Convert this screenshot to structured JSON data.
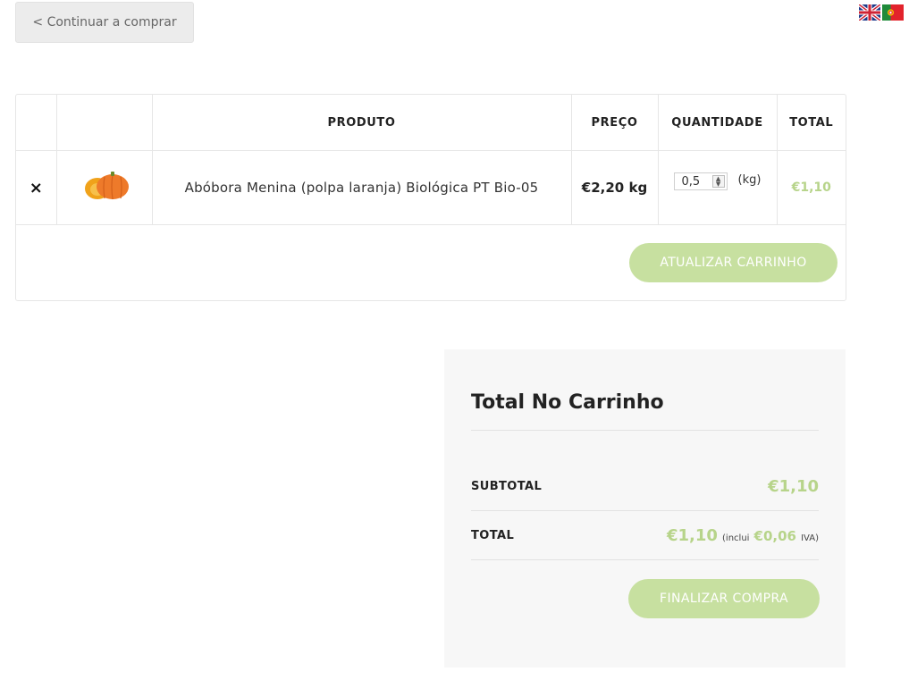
{
  "nav": {
    "continue_label": "< Continuar a comprar"
  },
  "languages": [
    "flag-uk",
    "flag-portugal"
  ],
  "cart": {
    "headers": {
      "remove": "",
      "thumbnail": "",
      "product": "PRODUTO",
      "price": "PREÇO",
      "quantity": "QUANTIDADE",
      "total": "TOTAL"
    },
    "items": [
      {
        "remove_symbol": "×",
        "thumbnail_icon": "pumpkin-icon",
        "name": "Abóbora Menina (polpa laranja) Biológica PT Bio-05",
        "price": "€2,20 kg",
        "quantity": "0,5",
        "unit": "(kg)",
        "total": "€1,10"
      }
    ],
    "update_label": "ATUALIZAR CARRINHO"
  },
  "totals": {
    "title": "Total No Carrinho",
    "subtotal_label": "SUBTOTAL",
    "subtotal_value": "€1,10",
    "total_label": "TOTAL",
    "total_value": "€1,10",
    "tax_prefix": "(inclui",
    "tax_value": "€0,06",
    "tax_suffix": "IVA)",
    "checkout_label": "FINALIZAR COMPRA"
  },
  "colors": {
    "accent": "#c7e0a0",
    "accent_text": "#b7d48a",
    "panel_bg": "#f7f7f7"
  }
}
